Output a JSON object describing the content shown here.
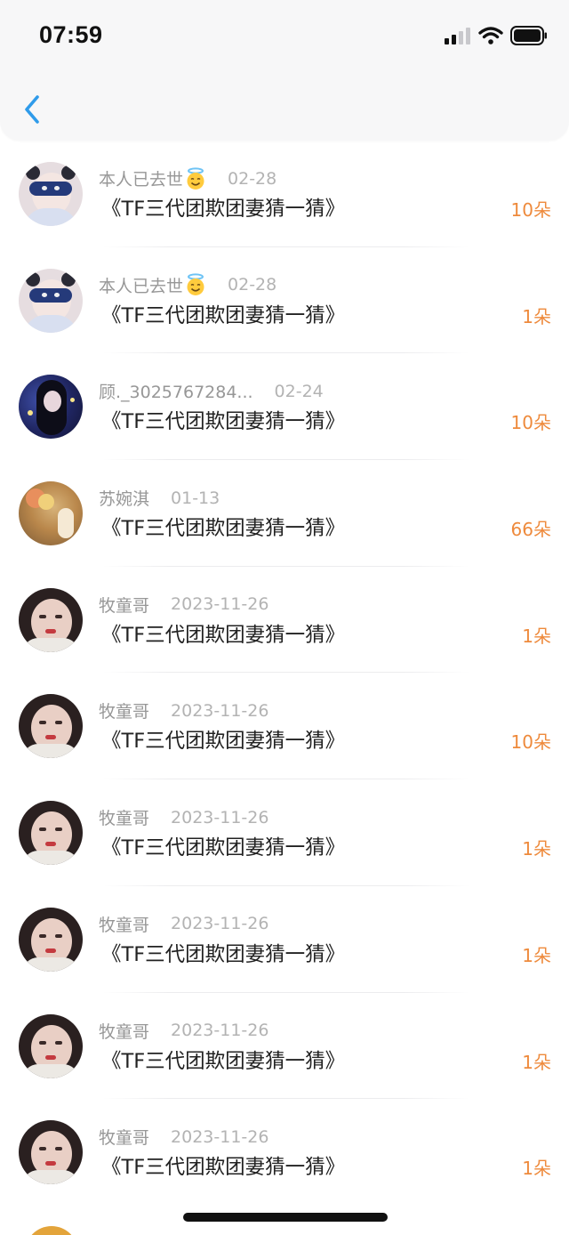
{
  "status_bar": {
    "time": "07:59",
    "icons": [
      "cellular-signal-icon",
      "wifi-icon",
      "battery-icon"
    ]
  },
  "nav": {
    "back_icon": "chevron-left-icon",
    "accent_color": "#2f9bea"
  },
  "colors": {
    "amount": "#ee8a3c",
    "name": "#979797",
    "date": "#b3b3b3",
    "title": "#222222"
  },
  "rows": [
    {
      "name": "本人已去世",
      "has_emoji": true,
      "date": "02-28",
      "title": "《TF三代团欺团妻猜一猜》",
      "amount": "10朵",
      "avatar": "avatar-sleep-mask"
    },
    {
      "name": "本人已去世",
      "has_emoji": true,
      "date": "02-28",
      "title": "《TF三代团欺团妻猜一猜》",
      "amount": "1朵",
      "avatar": "avatar-sleep-mask"
    },
    {
      "name": "顾._3025767284...",
      "has_emoji": false,
      "date": "02-24",
      "title": "《TF三代团欺团妻猜一猜》",
      "amount": "10朵",
      "avatar": "avatar-night-girl"
    },
    {
      "name": "苏婉淇",
      "has_emoji": false,
      "date": "01-13",
      "title": "《TF三代团欺团妻猜一猜》",
      "amount": "66朵",
      "avatar": "avatar-flowers"
    },
    {
      "name": "牧童哥",
      "has_emoji": false,
      "date": "2023-11-26",
      "title": "《TF三代团欺团妻猜一猜》",
      "amount": "1朵",
      "avatar": "avatar-girl-portrait"
    },
    {
      "name": "牧童哥",
      "has_emoji": false,
      "date": "2023-11-26",
      "title": "《TF三代团欺团妻猜一猜》",
      "amount": "10朵",
      "avatar": "avatar-girl-portrait"
    },
    {
      "name": "牧童哥",
      "has_emoji": false,
      "date": "2023-11-26",
      "title": "《TF三代团欺团妻猜一猜》",
      "amount": "1朵",
      "avatar": "avatar-girl-portrait"
    },
    {
      "name": "牧童哥",
      "has_emoji": false,
      "date": "2023-11-26",
      "title": "《TF三代团欺团妻猜一猜》",
      "amount": "1朵",
      "avatar": "avatar-girl-portrait"
    },
    {
      "name": "牧童哥",
      "has_emoji": false,
      "date": "2023-11-26",
      "title": "《TF三代团欺团妻猜一猜》",
      "amount": "1朵",
      "avatar": "avatar-girl-portrait"
    },
    {
      "name": "牧童哥",
      "has_emoji": false,
      "date": "2023-11-26",
      "title": "《TF三代团欺团妻猜一猜》",
      "amount": "1朵",
      "avatar": "avatar-girl-portrait"
    }
  ]
}
